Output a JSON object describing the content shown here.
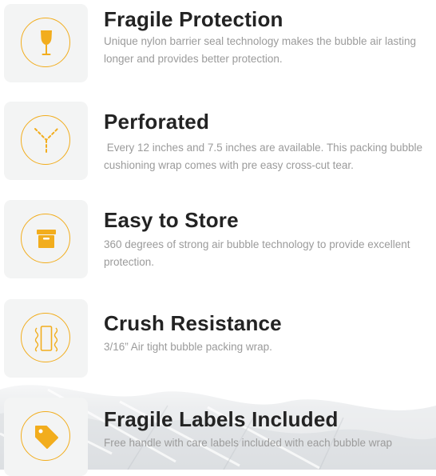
{
  "features": [
    {
      "icon": "wine-glass-icon",
      "title": "Fragile Protection",
      "description": "Unique nylon barrier seal technology makes the bubble air lasting longer and provides better protection."
    },
    {
      "icon": "perforation-tear-icon",
      "title": "Perforated",
      "description": " Every 12 inches and 7.5 inches are available. This packing bubble cushioning wrap comes with pre easy cross-cut tear."
    },
    {
      "icon": "storage-box-icon",
      "title": "Easy to Store",
      "description": "360 degrees of strong air bubble technology to provide excellent protection."
    },
    {
      "icon": "crush-resistance-icon",
      "title": "Crush Resistance",
      "description": "3/16” Air tight bubble packing wrap."
    },
    {
      "icon": "price-tag-icon",
      "title": "Fragile Labels Included",
      "description": "Free handle with care labels included with each bubble wrap"
    }
  ],
  "colors": {
    "accent": "#f2ad1d",
    "title": "#232323",
    "description": "#9b9b9b",
    "icon_box_background": "#f3f4f4"
  }
}
